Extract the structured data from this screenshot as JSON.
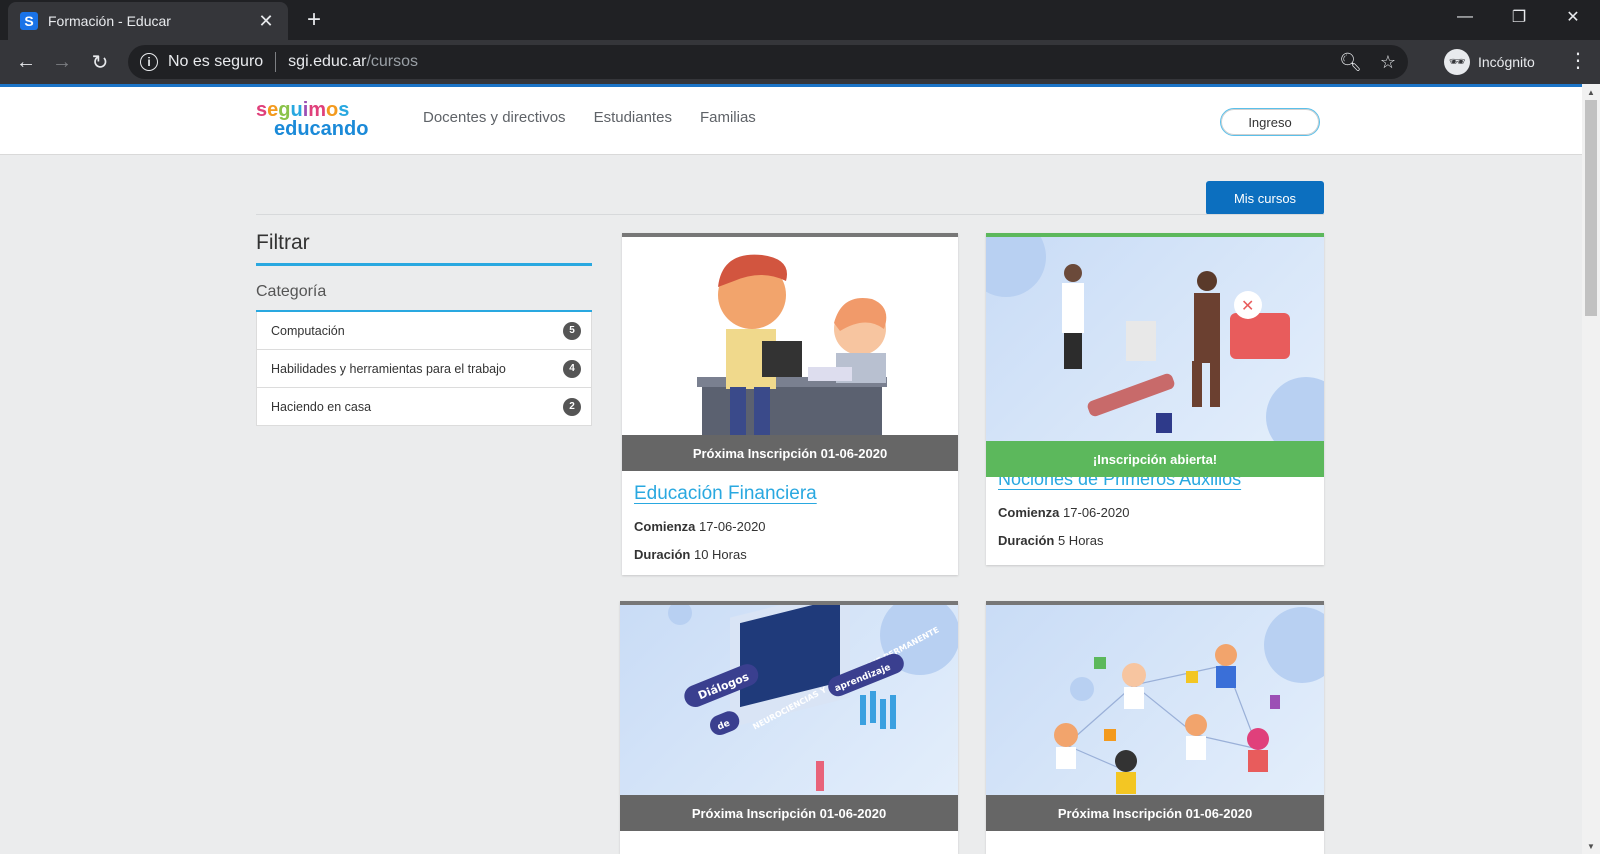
{
  "browser": {
    "tab_title": "Formación - Educar",
    "tab_favicon": "S",
    "security_text": "No es seguro",
    "url_host": "sgi.educ.ar",
    "url_path": "/cursos",
    "incognito_label": "Incógnito"
  },
  "header": {
    "logo_line1": "seguimos",
    "logo_line2": "educando",
    "nav": [
      "Docentes y directivos",
      "Estudiantes",
      "Familias"
    ],
    "login_label": "Ingreso"
  },
  "actions": {
    "my_courses": "Mis cursos"
  },
  "filter": {
    "title": "Filtrar",
    "category_title": "Categoría",
    "categories": [
      {
        "name": "Computación",
        "count": "5"
      },
      {
        "name": "Habilidades y herramientas para el trabajo",
        "count": "4"
      },
      {
        "name": "Haciendo en casa",
        "count": "2"
      }
    ]
  },
  "courses": [
    {
      "banner": "Próxima Inscripción 01-06-2020",
      "title": "Educación Financiera",
      "start_label": "Comienza",
      "start": "17-06-2020",
      "duration_label": "Duración",
      "duration": "10 Horas"
    },
    {
      "banner": "¡Inscripción abierta!",
      "title": "Nociones de Primeros Auxilios",
      "start_label": "Comienza",
      "start": "17-06-2020",
      "duration_label": "Duración",
      "duration": "5 Horas"
    },
    {
      "banner": "Próxima Inscripción 01-06-2020"
    },
    {
      "banner": "Próxima Inscripción 01-06-2020"
    }
  ],
  "illustration_text": {
    "dialogos": "Diálogos",
    "de": "de",
    "aprendizaje": "aprendizaje",
    "screen": "NEUROCIENCIAS Y APRENDIZAJE PERMANENTE"
  },
  "colors": {
    "accent": "#1b74c7",
    "link": "#29a8e0",
    "banner_closed": "#666666",
    "banner_open": "#5cb85c"
  }
}
